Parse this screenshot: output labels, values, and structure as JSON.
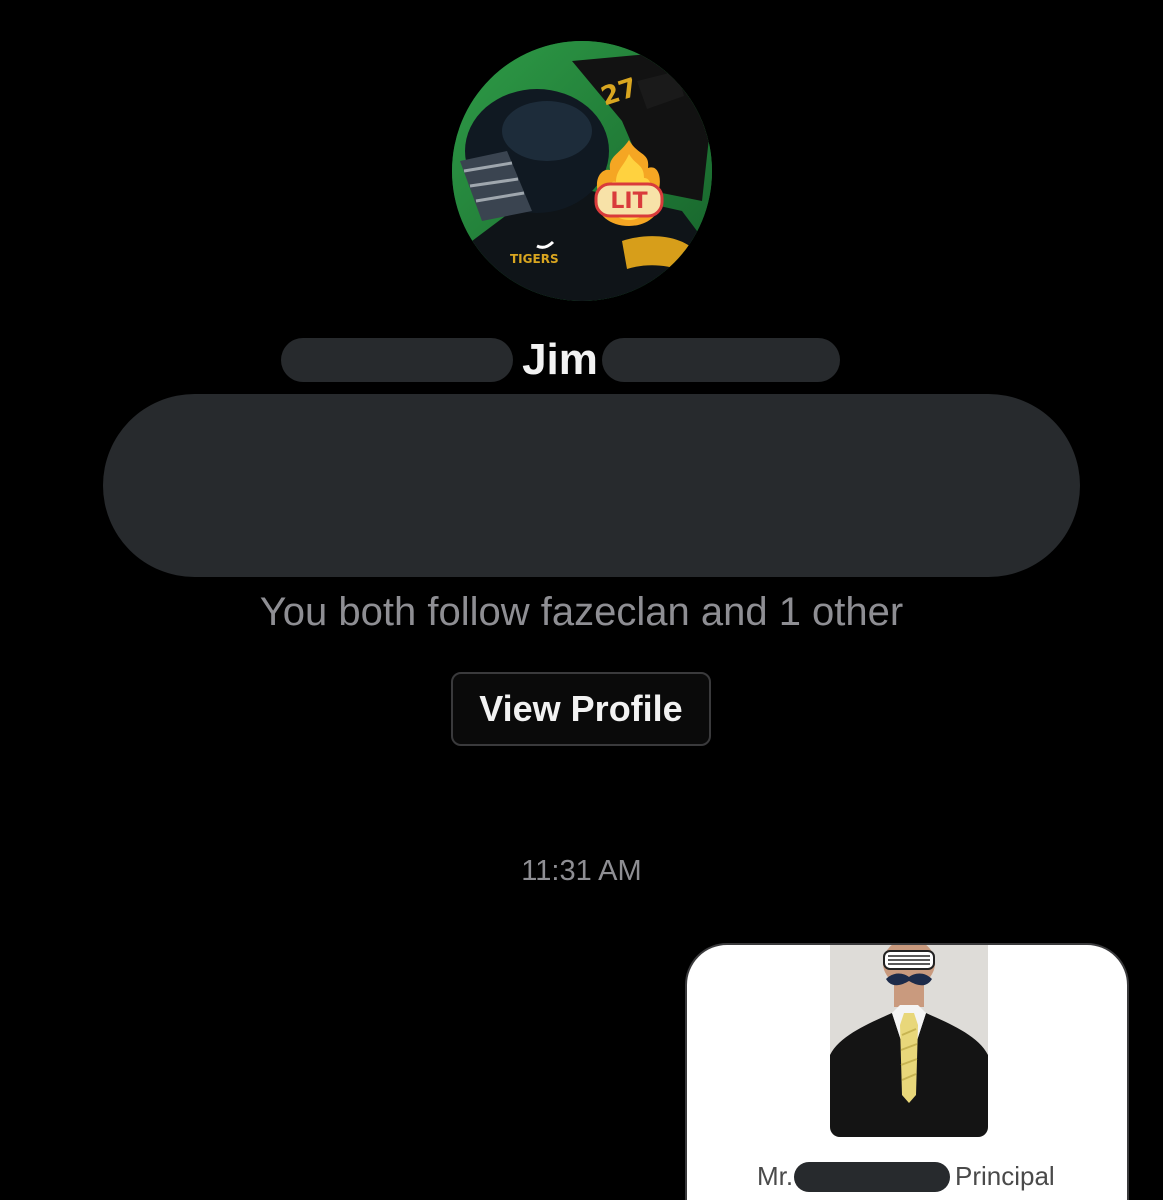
{
  "profile": {
    "name_visible": "Jim",
    "mutual_followers_text": "You both follow fazeclan and 1 other",
    "view_profile_label": "View Profile",
    "avatar_sticker_text": "LIT",
    "jersey_number": "27",
    "jersey_text": "TIGERS"
  },
  "conversation": {
    "timestamp": "11:31 AM",
    "shared_card": {
      "caption_prefix": "Mr.",
      "caption_title": "Principal"
    }
  },
  "colors": {
    "background": "#000000",
    "redaction": "#272a2d",
    "secondary_text": "#8e8e93",
    "primary_text": "#f2f2f2",
    "card_background": "#ffffff"
  }
}
